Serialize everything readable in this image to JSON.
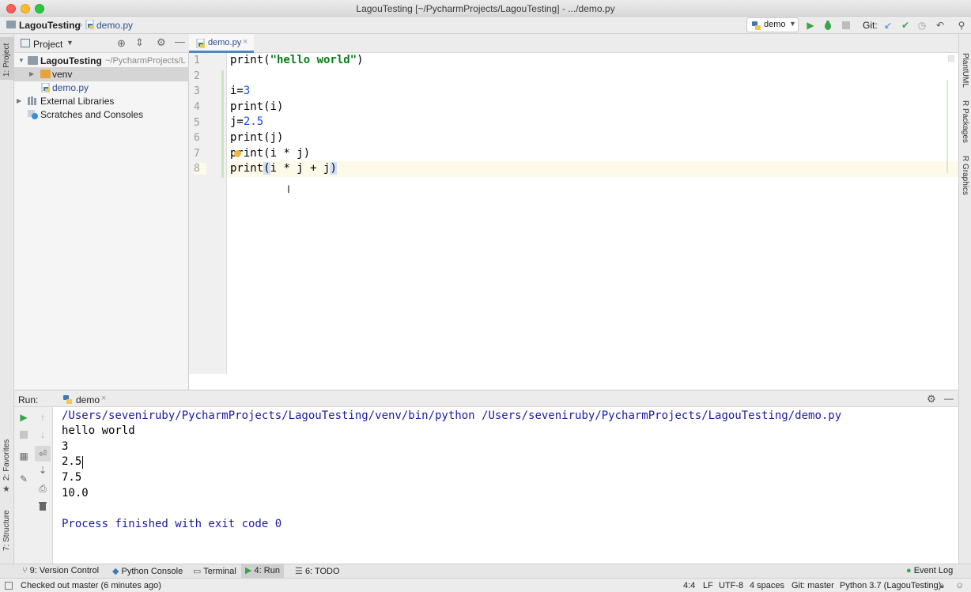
{
  "window": {
    "title": "LagouTesting [~/PycharmProjects/LagouTesting] - .../demo.py"
  },
  "navbar": {
    "project": "LagouTesting",
    "file": "demo.py",
    "run_config": "demo",
    "git_label": "Git:"
  },
  "left_stripe": {
    "project_tab": "1: Project",
    "favorites_tab": "2: Favorites",
    "structure_tab": "7: Structure"
  },
  "right_stripe": {
    "plantuml": "PlantUML",
    "r_packages": "R Packages",
    "r_graphics": "R Graphics"
  },
  "project_panel": {
    "title": "Project",
    "tree": [
      {
        "label": "LagouTesting",
        "path": "~/PycharmProjects/L"
      },
      {
        "label": "venv"
      },
      {
        "label": "demo.py"
      },
      {
        "label": "External Libraries"
      },
      {
        "label": "Scratches and Consoles"
      }
    ]
  },
  "editor": {
    "tab": "demo.py",
    "line_numbers": [
      "1",
      "2",
      "3",
      "4",
      "5",
      "6",
      "7",
      "8"
    ]
  },
  "run_panel": {
    "label": "Run:",
    "tab": "demo",
    "output": [
      "/Users/seveniruby/PycharmProjects/LagouTesting/venv/bin/python /Users/seveniruby/PycharmProjects/LagouTesting/demo.py",
      "hello world",
      "3",
      "2.5",
      "7.5",
      "10.0",
      "",
      "Process finished with exit code 0"
    ]
  },
  "bottom_tools": {
    "version_control": "9: Version Control",
    "python_console": "Python Console",
    "terminal": "Terminal",
    "run": "4: Run",
    "todo": "6: TODO",
    "event_log": "Event Log"
  },
  "statusbar": {
    "message": "Checked out master (6 minutes ago)",
    "position": "4:4",
    "line_sep": "LF",
    "encoding": "UTF-8",
    "indent": "4 spaces",
    "git_branch": "Git: master",
    "interpreter": "Python 3.7 (LagouTesting)"
  },
  "colors": {
    "string": "#067d17",
    "number": "#1750eb",
    "console_system": "#1a1aa6",
    "selection": "#d5d5d5"
  }
}
